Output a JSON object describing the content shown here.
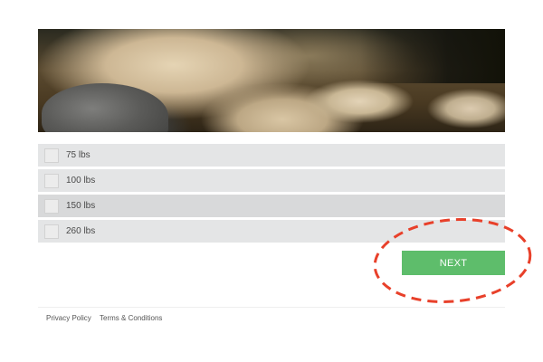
{
  "quiz": {
    "options": [
      {
        "label": "75 lbs",
        "checked": false
      },
      {
        "label": "100 lbs",
        "checked": false
      },
      {
        "label": "150 lbs",
        "checked": false
      },
      {
        "label": "260 lbs",
        "checked": false
      }
    ],
    "next_label": "NEXT",
    "next_color": "#5ebd6b"
  },
  "annotation": {
    "color": "#e8402a"
  },
  "footer": {
    "privacy_label": "Privacy Policy",
    "terms_label": "Terms & Conditions"
  }
}
